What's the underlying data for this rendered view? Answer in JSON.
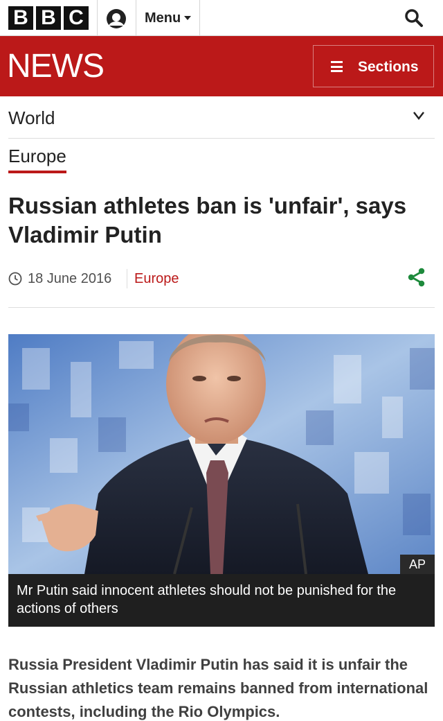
{
  "header": {
    "logo_letters": [
      "B",
      "B",
      "C"
    ],
    "menu_label": "Menu",
    "icons": {
      "account": "account-icon",
      "search": "search-icon"
    }
  },
  "news_bar": {
    "title": "NEWS",
    "sections_label": "Sections",
    "color": "#bb1919"
  },
  "nav": {
    "section": "World",
    "subsection": "Europe"
  },
  "article": {
    "headline": "Russian athletes ban is 'unfair', says Vladimir Putin",
    "date": "18 June 2016",
    "section_link": "Europe",
    "image_credit": "AP",
    "caption": "Mr Putin said innocent athletes should not be punished for the actions of others",
    "summary": "Russia President Vladimir Putin has said it is unfair the Russian athletics team remains banned from international contests, including the Rio Olympics."
  },
  "colors": {
    "brand_red": "#bb1919",
    "share_green": "#1e8a3c",
    "text_dark": "#222222"
  }
}
